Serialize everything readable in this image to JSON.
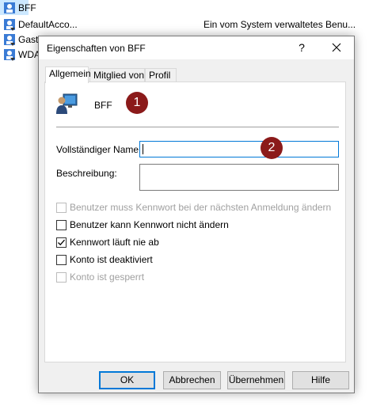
{
  "background_list": [
    {
      "name": "BFF",
      "description": ""
    },
    {
      "name": "DefaultAcco...",
      "description": "Ein vom System verwaltetes Benu..."
    },
    {
      "name": "Gast",
      "description": ""
    },
    {
      "name": "WDA",
      "description": ""
    }
  ],
  "dialog": {
    "title": "Eigenschaften von BFF",
    "help_glyph": "?",
    "tabs": [
      "Allgemein",
      "Mitglied von",
      "Profil"
    ],
    "user_name": "BFF",
    "full_name_label": "Vollständiger Name:",
    "full_name_value": "",
    "description_label": "Beschreibung:",
    "description_value": "",
    "checkboxes": [
      {
        "label": "Benutzer muss Kennwort bei der nächsten Anmeldung ändern",
        "checked": false,
        "enabled": false
      },
      {
        "label": "Benutzer kann Kennwort nicht ändern",
        "checked": false,
        "enabled": true
      },
      {
        "label": "Kennwort läuft nie ab",
        "checked": true,
        "enabled": true
      },
      {
        "label": "Konto ist deaktiviert",
        "checked": false,
        "enabled": true
      },
      {
        "label": "Konto ist gesperrt",
        "checked": false,
        "enabled": false
      }
    ],
    "buttons": {
      "ok": "OK",
      "cancel": "Abbrechen",
      "apply": "Übernehmen",
      "help": "Hilfe"
    }
  },
  "markers": [
    "1",
    "2"
  ],
  "colors": {
    "accent": "#0078d7",
    "marker": "#8b1a1a",
    "selection": "#cce8ff"
  }
}
